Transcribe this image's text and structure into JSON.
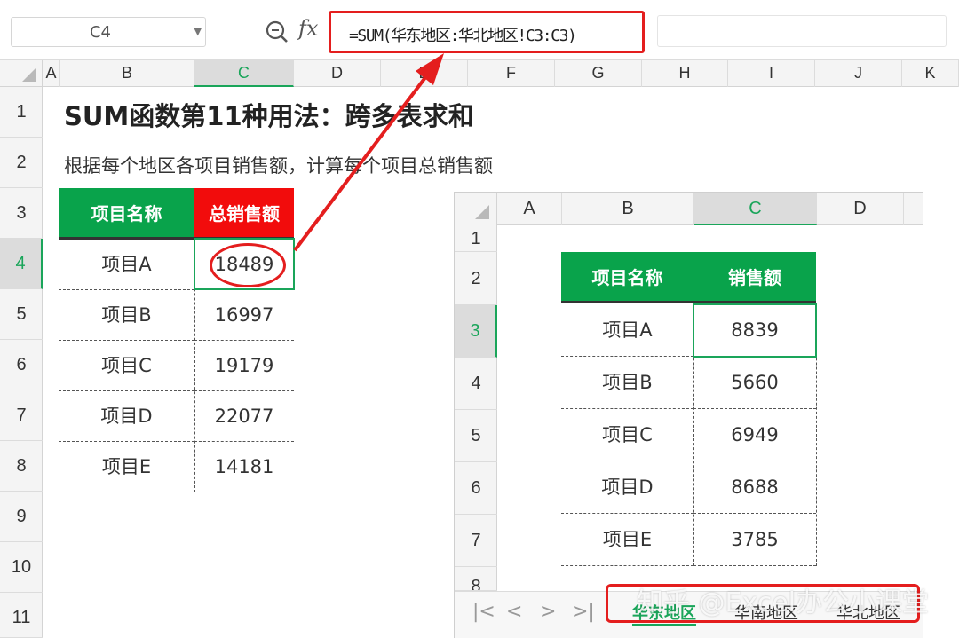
{
  "formula_bar": {
    "name_box": "C4",
    "fx_label": "fx",
    "formula": "=SUM(华东地区:华北地区!C3:C3)",
    "zoom_icon": "zoom-formula-icon"
  },
  "columns": [
    "A",
    "B",
    "C",
    "D",
    "E",
    "F",
    "G",
    "H",
    "I",
    "J",
    "K"
  ],
  "rows": [
    "1",
    "2",
    "3",
    "4",
    "5",
    "6",
    "7",
    "8",
    "9",
    "10",
    "11"
  ],
  "selected_cell": "C4",
  "sheet": {
    "title": "SUM函数第11种用法：跨多表求和",
    "subtitle": "根据每个地区各项目销售额，计算每个项目总销售额",
    "headers": {
      "name": "项目名称",
      "total": "总销售额"
    },
    "items": [
      {
        "name": "项目A",
        "total": "18489"
      },
      {
        "name": "项目B",
        "total": "16997"
      },
      {
        "name": "项目C",
        "total": "19179"
      },
      {
        "name": "项目D",
        "total": "22077"
      },
      {
        "name": "项目E",
        "total": "14181"
      }
    ]
  },
  "inset": {
    "columns": [
      "A",
      "B",
      "C",
      "D"
    ],
    "rows": [
      "1",
      "2",
      "3",
      "4",
      "5",
      "6",
      "7",
      "8"
    ],
    "headers": {
      "name": "项目名称",
      "sales": "销售额"
    },
    "items": [
      {
        "name": "项目A",
        "sales": "8839"
      },
      {
        "name": "项目B",
        "sales": "5660"
      },
      {
        "name": "项目C",
        "sales": "6949"
      },
      {
        "name": "项目D",
        "sales": "8688"
      },
      {
        "name": "项目E",
        "sales": "3785"
      }
    ],
    "tabs": [
      "华东地区",
      "华南地区",
      "华北地区"
    ],
    "active_tab": "华东地区"
  },
  "watermark": "知乎 @Excel办公小课堂",
  "colors": {
    "header_green": "#09a34b",
    "header_red": "#f20c0c",
    "selection_green": "#1aa55a",
    "annotation_red": "#e41e1e"
  }
}
